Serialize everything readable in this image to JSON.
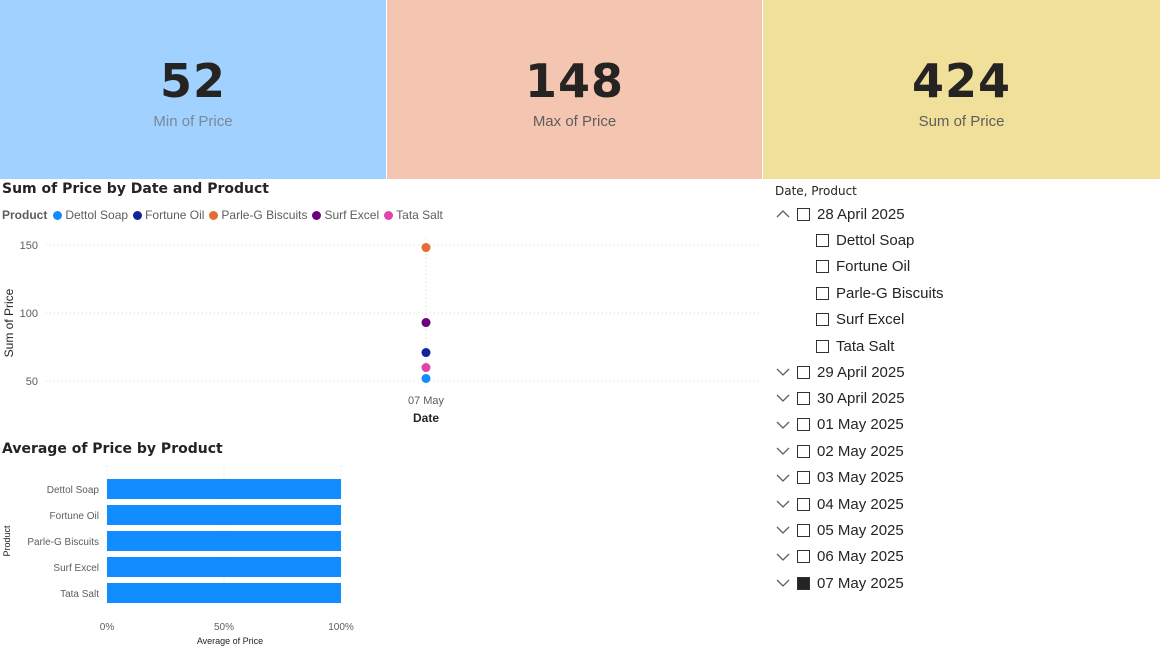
{
  "cards": [
    {
      "value": "52",
      "label": "Min of Price",
      "bg": "#a0d1ff",
      "label_color": "#7a8999"
    },
    {
      "value": "148",
      "label": "Max of Price",
      "bg": "#f4c5b0",
      "label_color": "#605e5c"
    },
    {
      "value": "424",
      "label": "Sum of Price",
      "bg": "#f0e09a",
      "label_color": "#605e5c"
    }
  ],
  "scatter": {
    "title": "Sum of Price by Date and Product",
    "legend_title": "Product",
    "legend": [
      {
        "name": "Dettol Soap",
        "color": "#118dff"
      },
      {
        "name": "Fortune Oil",
        "color": "#12239e"
      },
      {
        "name": "Parle-G Biscuits",
        "color": "#e66c37"
      },
      {
        "name": "Surf Excel",
        "color": "#6b007b"
      },
      {
        "name": "Tata Salt",
        "color": "#e044a7"
      }
    ]
  },
  "bar": {
    "title": "Average of Price by Product"
  },
  "chart_data": [
    {
      "type": "scatter",
      "title": "Sum of Price by Date and Product",
      "xlabel": "Date",
      "ylabel": "Sum of Price",
      "x_ticks": [
        "07 May"
      ],
      "y_ticks": [
        50,
        100,
        150
      ],
      "ylim": [
        45,
        155
      ],
      "grid": true,
      "legend_position": "top-left",
      "series": [
        {
          "name": "Dettol Soap",
          "x": [
            "07 May"
          ],
          "values": [
            52
          ],
          "color": "#118dff"
        },
        {
          "name": "Fortune Oil",
          "x": [
            "07 May"
          ],
          "values": [
            71
          ],
          "color": "#12239e"
        },
        {
          "name": "Parle-G Biscuits",
          "x": [
            "07 May"
          ],
          "values": [
            148
          ],
          "color": "#e66c37"
        },
        {
          "name": "Surf Excel",
          "x": [
            "07 May"
          ],
          "values": [
            93
          ],
          "color": "#6b007b"
        },
        {
          "name": "Tata Salt",
          "x": [
            "07 May"
          ],
          "values": [
            60
          ],
          "color": "#e044a7"
        }
      ]
    },
    {
      "type": "bar",
      "orientation": "horizontal",
      "title": "Average of Price by Product",
      "xlabel": "Average of Price",
      "ylabel": "Product",
      "categories": [
        "Dettol Soap",
        "Fortune Oil",
        "Parle-G Biscuits",
        "Surf Excel",
        "Tata Salt"
      ],
      "values": [
        100,
        100,
        100,
        100,
        100
      ],
      "x_ticks": [
        "0%",
        "50%",
        "100%"
      ],
      "xlim": [
        0,
        100
      ],
      "color": "#118dff",
      "grid": true
    }
  ],
  "slicer": {
    "title": "Date, Product",
    "expanded": {
      "label": "28 April 2025",
      "children": [
        "Dettol Soap",
        "Fortune Oil",
        "Parle-G Biscuits",
        "Surf Excel",
        "Tata Salt"
      ]
    },
    "collapsed": [
      {
        "label": "29 April 2025",
        "checked": false
      },
      {
        "label": "30 April 2025",
        "checked": false
      },
      {
        "label": "01 May 2025",
        "checked": false
      },
      {
        "label": "02 May 2025",
        "checked": false
      },
      {
        "label": "03 May 2025",
        "checked": false
      },
      {
        "label": "04 May 2025",
        "checked": false
      },
      {
        "label": "05 May 2025",
        "checked": false
      },
      {
        "label": "06 May 2025",
        "checked": false
      },
      {
        "label": "07 May 2025",
        "checked": true
      }
    ]
  }
}
